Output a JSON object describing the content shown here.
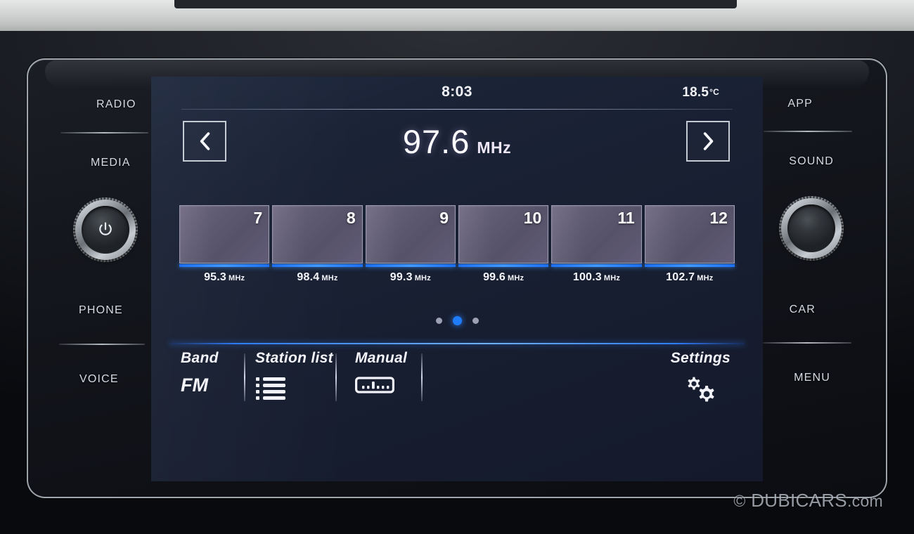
{
  "device": {
    "type": "car-infotainment-head-unit",
    "left_bezel": [
      {
        "label": "RADIO",
        "name": "radio"
      },
      {
        "label": "MEDIA",
        "name": "media"
      },
      {
        "label": "PHONE",
        "name": "phone"
      },
      {
        "label": "VOICE",
        "name": "voice"
      }
    ],
    "right_bezel": [
      {
        "label": "APP",
        "name": "app"
      },
      {
        "label": "SOUND",
        "name": "sound"
      },
      {
        "label": "CAR",
        "name": "car"
      },
      {
        "label": "MENU",
        "name": "menu"
      }
    ],
    "knobs": [
      {
        "name": "power-volume-knob",
        "icon": "power-icon"
      },
      {
        "name": "tune-knob",
        "icon": "none"
      }
    ]
  },
  "statusbar": {
    "clock": "8:03",
    "temperature": "18.5",
    "temperature_unit": "°C"
  },
  "tuner": {
    "prev_icon": "chevron-left-icon",
    "next_icon": "chevron-right-icon",
    "frequency": "97.6",
    "unit": "MHz"
  },
  "presets": [
    {
      "number": "7",
      "frequency": "95.3",
      "unit": "MHz"
    },
    {
      "number": "8",
      "frequency": "98.4",
      "unit": "MHz"
    },
    {
      "number": "9",
      "frequency": "99.3",
      "unit": "MHz"
    },
    {
      "number": "10",
      "frequency": "99.6",
      "unit": "MHz"
    },
    {
      "number": "11",
      "frequency": "100.3",
      "unit": "MHz"
    },
    {
      "number": "12",
      "frequency": "102.7",
      "unit": "MHz"
    }
  ],
  "pagination": {
    "pages": 3,
    "active_index": 1
  },
  "toolbar": {
    "band_label": "Band",
    "band_value": "FM",
    "station_list_label": "Station list",
    "station_list_icon": "list-icon",
    "manual_label": "Manual",
    "manual_icon": "tuning-scale-icon",
    "settings_label": "Settings",
    "settings_icon": "gears-icon"
  },
  "watermark": {
    "copyright": "©",
    "brand": "DUBICARS",
    "tld": ".com"
  },
  "colors": {
    "screen_background": "#1a2235",
    "accent_blue": "#2f7dfb",
    "preset_tile": "#5e5a72",
    "text": "#f2f3f8",
    "bezel_text": "#d7dbe2"
  }
}
